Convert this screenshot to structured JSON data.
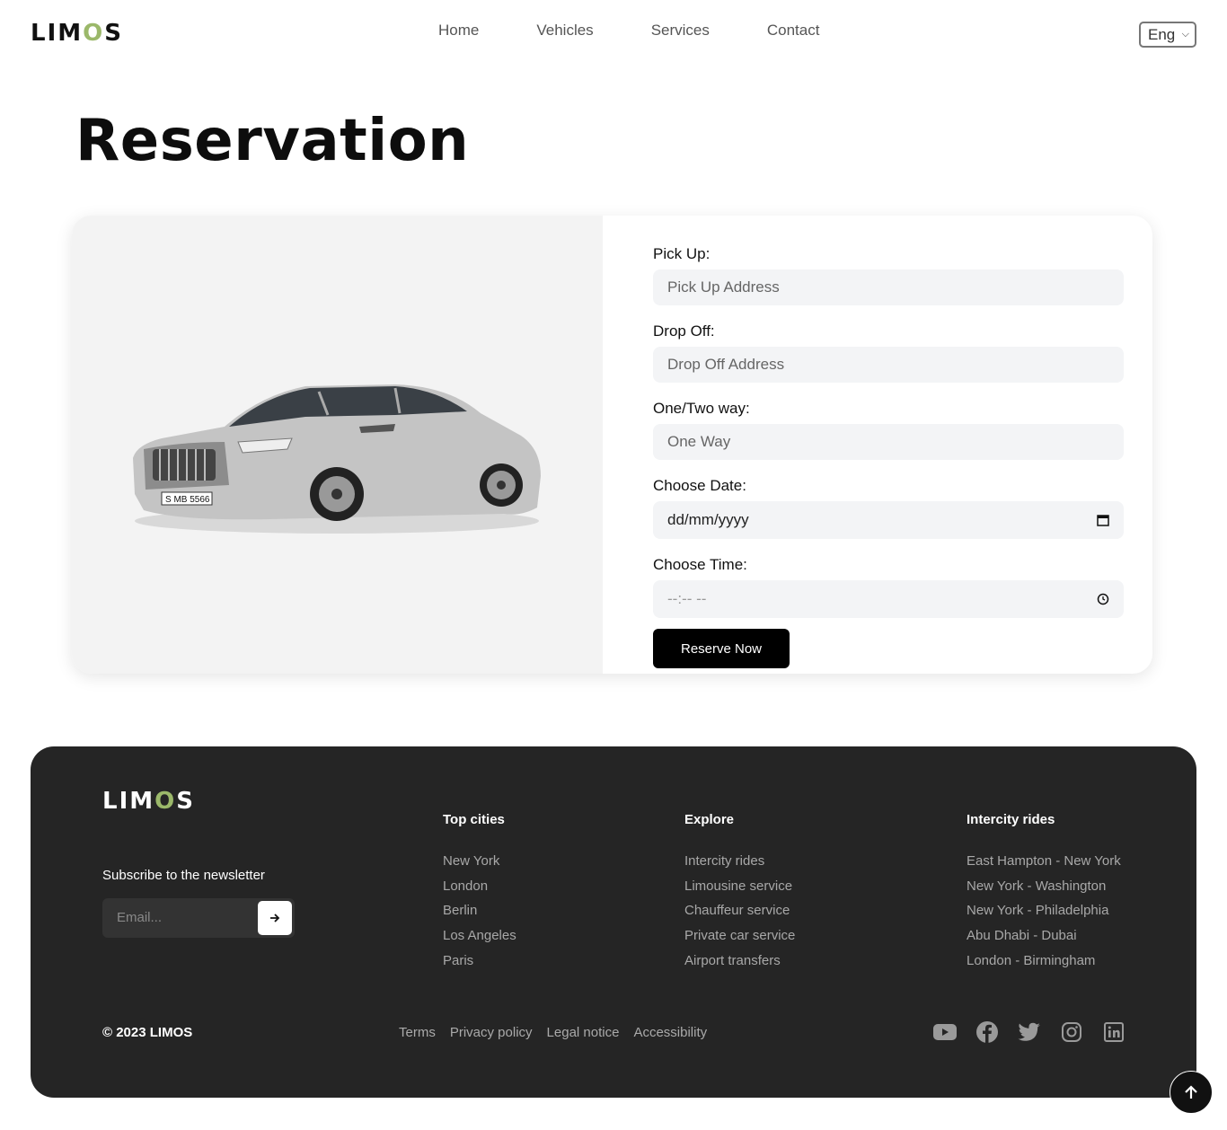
{
  "header": {
    "logo": {
      "left": "LIM",
      "mid": "O",
      "right": "S"
    },
    "nav": [
      "Home",
      "Vehicles",
      "Services",
      "Contact"
    ],
    "language": "Eng"
  },
  "page_title": "Reservation",
  "form": {
    "pickup_label": "Pick Up:",
    "pickup_placeholder": "Pick Up Address",
    "dropoff_label": "Drop Off:",
    "dropoff_placeholder": "Drop Off Address",
    "trip_label": "One/Two way:",
    "trip_value": "One Way",
    "date_label": "Choose Date:",
    "date_value": "dd/mm/yyyy",
    "time_label": "Choose Time:",
    "time_value": "--:-- --",
    "submit": "Reserve Now"
  },
  "car": {
    "plate": "S MB 5566"
  },
  "footer": {
    "logo": {
      "left": "LIM",
      "mid": "O",
      "right": "S"
    },
    "subscribe": "Subscribe to the newsletter",
    "email_placeholder": "Email...",
    "top_cities": {
      "title": "Top cities",
      "items": [
        "New York",
        "London",
        "Berlin",
        "Los Angeles",
        "Paris"
      ]
    },
    "explore": {
      "title": "Explore",
      "items": [
        "Intercity rides",
        "Limousine service",
        "Chauffeur service",
        "Private car service",
        "Airport transfers"
      ]
    },
    "intercity": {
      "title": "Intercity rides",
      "items": [
        "East Hampton - New York",
        "New York - Washington",
        "New York - Philadelphia",
        "Abu Dhabi - Dubai",
        "London - Birmingham"
      ]
    },
    "copyright": "© 2023 LIMOS",
    "legal": [
      "Terms",
      "Privacy policy",
      "Legal notice",
      "Accessibility"
    ],
    "socials": [
      "youtube-icon",
      "facebook-icon",
      "twitter-icon",
      "instagram-icon",
      "linkedin-icon"
    ]
  },
  "colors": {
    "accent": "#9bb86a",
    "footer_bg": "#252525",
    "field_bg": "#f3f4f6"
  }
}
